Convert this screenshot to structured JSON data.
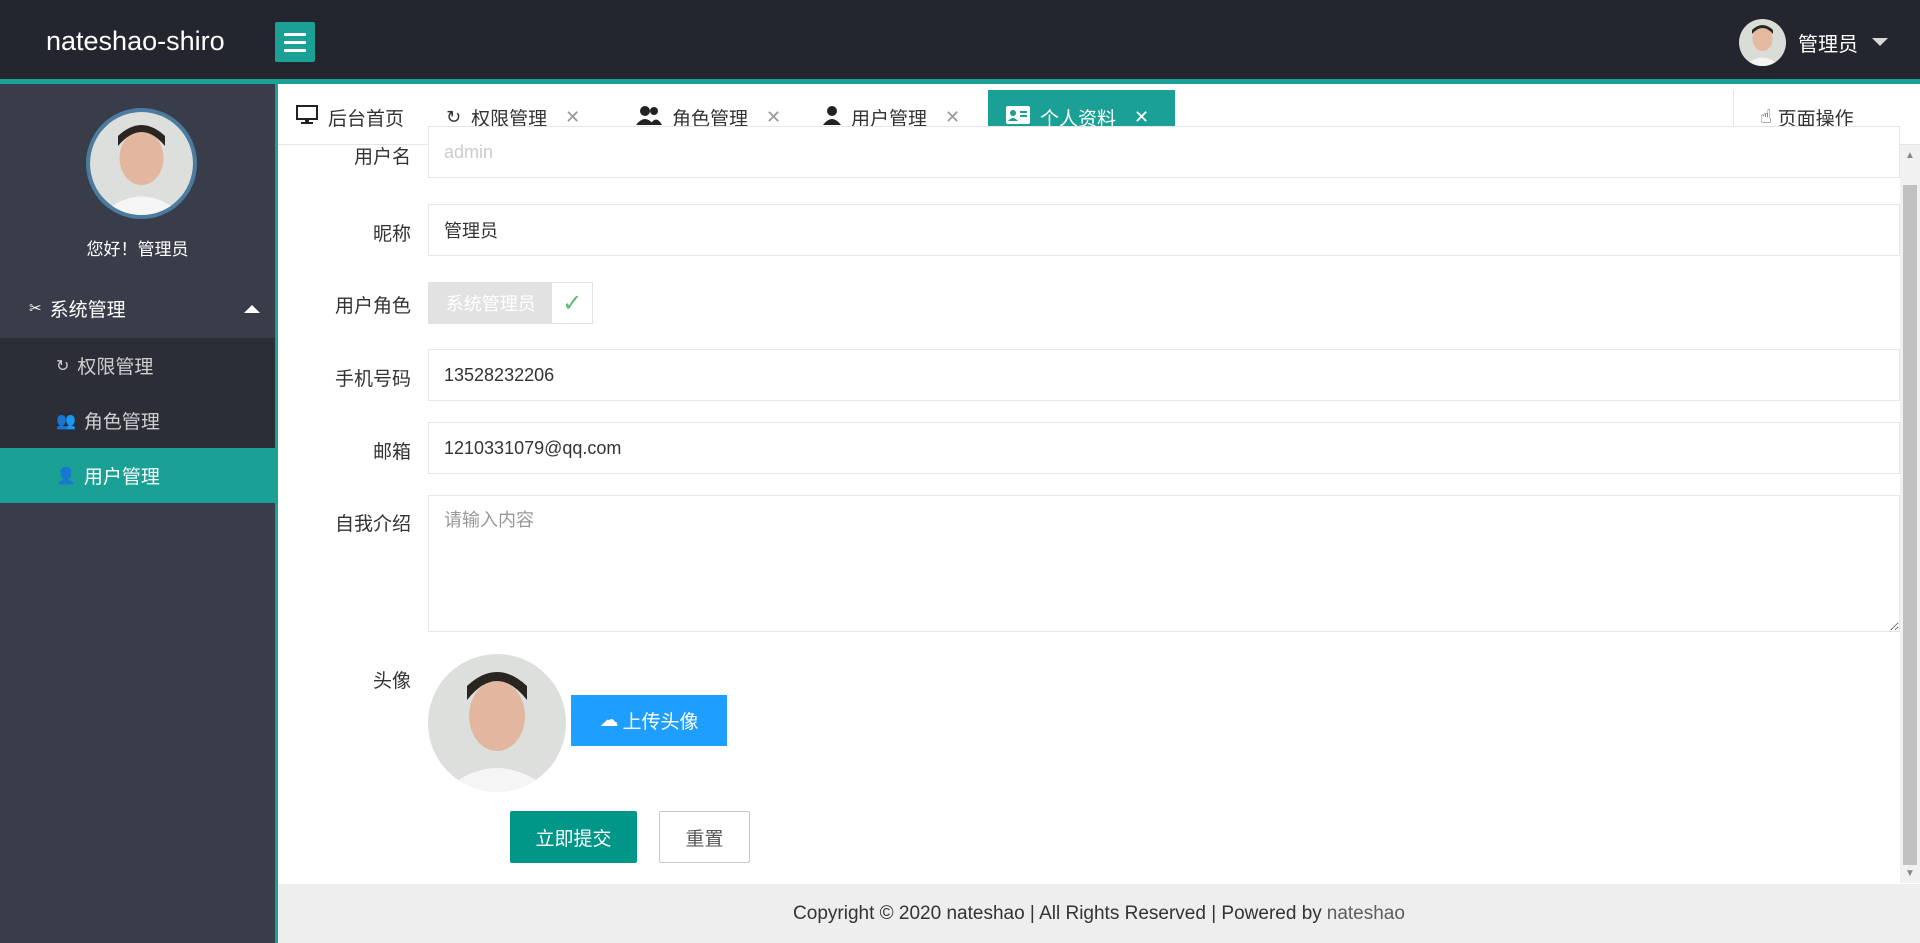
{
  "header": {
    "logo": "nateshao-shiro",
    "user_name": "管理员"
  },
  "sidebar": {
    "greeting": "您好！管理员",
    "group": {
      "label": "系统管理",
      "icon": "tools-icon"
    },
    "items": [
      {
        "label": "权限管理",
        "icon": "permission-icon"
      },
      {
        "label": "角色管理",
        "icon": "users-icon"
      },
      {
        "label": "用户管理",
        "icon": "user-icon",
        "active": true
      }
    ]
  },
  "tabs": [
    {
      "label": "后台首页",
      "icon": "monitor-icon",
      "closable": false
    },
    {
      "label": "权限管理",
      "icon": "permission-icon",
      "closable": true
    },
    {
      "label": "角色管理",
      "icon": "users-icon",
      "closable": true
    },
    {
      "label": "用户管理",
      "icon": "user-icon",
      "closable": true
    },
    {
      "label": "个人资料",
      "icon": "id-card-icon",
      "closable": true,
      "active": true
    }
  ],
  "page_ops": {
    "label": "页面操作",
    "icon": "hand-pointer-icon"
  },
  "form": {
    "username": {
      "label": "用户名",
      "value": "admin"
    },
    "nickname": {
      "label": "昵称",
      "value": "管理员"
    },
    "role": {
      "label": "用户角色",
      "value": "系统管理员"
    },
    "phone": {
      "label": "手机号码",
      "value": "13528232206"
    },
    "email": {
      "label": "邮箱",
      "value": "1210331079@qq.com"
    },
    "intro": {
      "label": "自我介绍",
      "placeholder": "请输入内容"
    },
    "avatar": {
      "label": "头像",
      "upload_label": "上传头像"
    },
    "submit_label": "立即提交",
    "reset_label": "重置"
  },
  "footer": {
    "text": "Copyright © 2020 nateshao | All Rights Reserved | Powered by",
    "link": "nateshao"
  },
  "colors": {
    "accent": "#1aa094",
    "header_bg": "#23262e",
    "sidebar_bg": "#393d49",
    "upload_btn": "#1e9fff",
    "submit_btn": "#009688"
  }
}
